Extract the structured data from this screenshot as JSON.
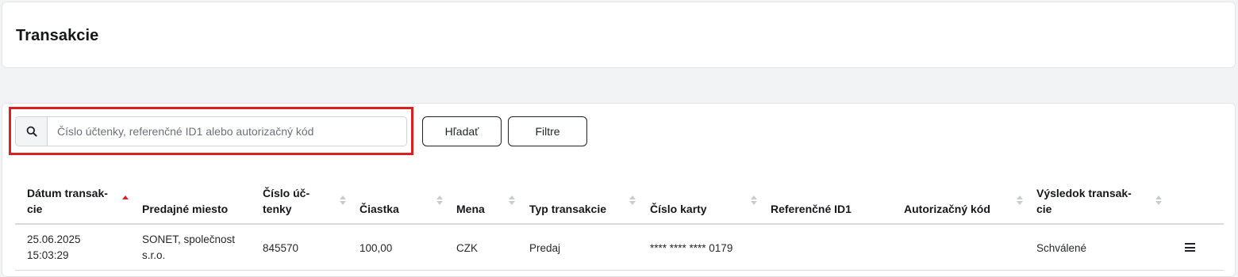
{
  "header": {
    "title": "Transakcie"
  },
  "search": {
    "placeholder": "Číslo účtenky, referenčné ID1 alebo autorizačný kód",
    "value": "",
    "search_button": "Hľadať",
    "filter_button": "Filtre"
  },
  "table": {
    "columns": [
      {
        "line1": "Dátum transak-",
        "line2": "cie",
        "sortable": true,
        "sort": "asc"
      },
      {
        "line1": "",
        "line2": "Predajné miesto",
        "sortable": false
      },
      {
        "line1": "Číslo úč-",
        "line2": "tenky",
        "sortable": true
      },
      {
        "line1": "",
        "line2": "Čiastka",
        "sortable": true
      },
      {
        "line1": "",
        "line2": "Mena",
        "sortable": true
      },
      {
        "line1": "",
        "line2": "Typ transakcie",
        "sortable": true
      },
      {
        "line1": "",
        "line2": "Číslo karty",
        "sortable": true
      },
      {
        "line1": "",
        "line2": "Referenčné ID1",
        "sortable": false
      },
      {
        "line1": "",
        "line2": "Autorizačný kód",
        "sortable": true
      },
      {
        "line1": "Výsledok transak-",
        "line2": "cie",
        "sortable": true
      }
    ],
    "rows": [
      {
        "date": "25.06.2025",
        "time": "15:03:29",
        "merchant_line1": "SONET, společnost",
        "merchant_line2": "s.r.o.",
        "receipt": "845570",
        "amount": "100,00",
        "currency": "CZK",
        "type": "Predaj",
        "card": "**** **** **** 0179",
        "reference_id": "",
        "auth_code": "",
        "result": "Schválené",
        "actions_icon": "hamburger-menu-icon"
      }
    ]
  },
  "colors": {
    "accent_sort": "#d92121",
    "highlight": "#d92121"
  }
}
